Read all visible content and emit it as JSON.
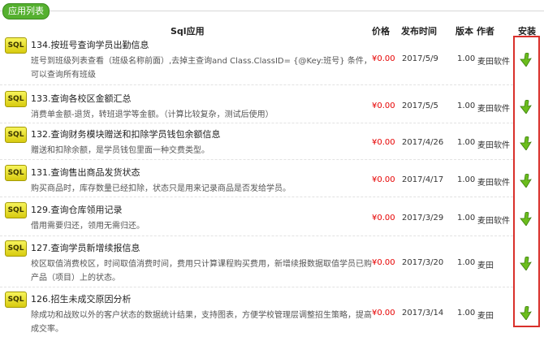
{
  "tab": {
    "label": "应用列表"
  },
  "columns": {
    "app": "Sql应用",
    "price": "价格",
    "date": "发布时间",
    "version": "版本",
    "author": "作者",
    "install": "安装"
  },
  "badge_text": "SQL",
  "rows": [
    {
      "title": "134.按班号查询学员出勤信息",
      "desc": "班号到班级列表查看（班级名称前面）,去掉主查询and Class.ClassID= {@Key:班号} 条件，可以查询所有班级",
      "price": "¥0.00",
      "date": "2017/5/9",
      "version": "1.00",
      "author": "麦田软件"
    },
    {
      "title": "133.查询各校区金额汇总",
      "desc": "消费单金额-退货，转班退学等金额。（计算比较复杂，测试后使用）",
      "price": "¥0.00",
      "date": "2017/5/5",
      "version": "1.00",
      "author": "麦田软件"
    },
    {
      "title": "132.查询财务模块赠送和扣除学员钱包余额信息",
      "desc": "赠送和扣除余额，是学员钱包里面一种交费类型。",
      "price": "¥0.00",
      "date": "2017/4/26",
      "version": "1.00",
      "author": "麦田软件"
    },
    {
      "title": "131.查询售出商品发货状态",
      "desc": "购买商品时，库存数量已经扣除，状态只是用来记录商品是否发给学员。",
      "price": "¥0.00",
      "date": "2017/4/17",
      "version": "1.00",
      "author": "麦田软件"
    },
    {
      "title": "129.查询仓库领用记录",
      "desc": "借用需要归还，领用无需归还。",
      "price": "¥0.00",
      "date": "2017/3/29",
      "version": "1.00",
      "author": "麦田软件"
    },
    {
      "title": "127.查询学员新增续报信息",
      "desc": "校区取值消费校区，时间取值消费时间，费用只计算课程购买费用，新增续报数据取值学员已购产品（项目）上的状态。",
      "price": "¥0.00",
      "date": "2017/3/20",
      "version": "1.00",
      "author": "麦田"
    },
    {
      "title": "126.招生未成交原因分析",
      "desc": "除成功和战败以外的客户状态的数据统计结果，支持图表，方便学校管理层调整招生策略，提高成交率。",
      "price": "¥0.00",
      "date": "2017/3/14",
      "version": "1.00",
      "author": "麦田"
    }
  ],
  "colors": {
    "accent_green": "#55b02f",
    "price_red": "#e60000",
    "highlight_red": "#d9302b",
    "badge_yellow": "#e8df26"
  },
  "icons": {
    "install": "green-down-arrow-icon",
    "app": "sql-badge-icon"
  }
}
